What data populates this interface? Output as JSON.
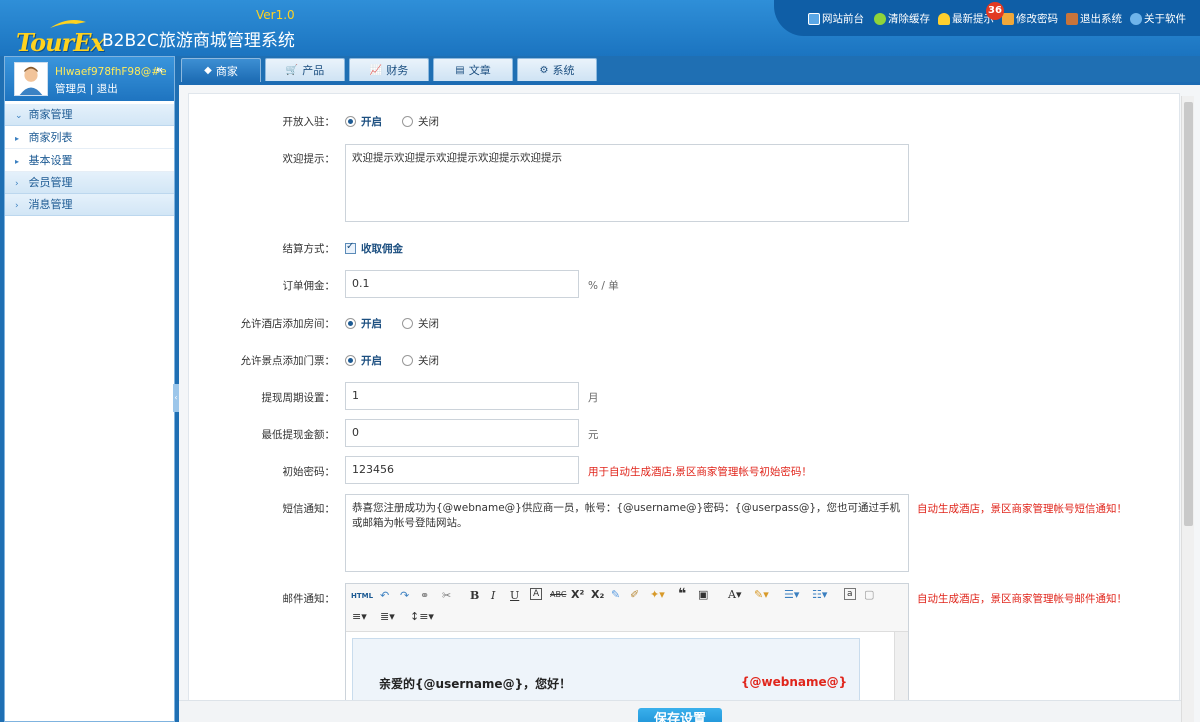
{
  "header": {
    "logo_text": "TourEx",
    "title": "B2B2C旅游商城管理系统",
    "version": "Ver1.0",
    "links": [
      {
        "label": "网站前台",
        "icon": "monitor-icon"
      },
      {
        "label": "清除缓存",
        "icon": "refresh-icon"
      },
      {
        "label": "最新提示",
        "icon": "bell-icon"
      },
      {
        "label": "修改密码",
        "icon": "lock-icon"
      },
      {
        "label": "退出系统",
        "icon": "exit-icon"
      },
      {
        "label": "关于软件",
        "icon": "info-icon"
      }
    ],
    "notification_count": "36"
  },
  "user": {
    "name": "Hlwaef978fhF98@#e",
    "role": "管理员 | 退出"
  },
  "sidebar": {
    "groups": [
      {
        "label": "商家管理",
        "expanded": true
      },
      {
        "label": "会员管理",
        "expanded": false
      },
      {
        "label": "消息管理",
        "expanded": false
      }
    ],
    "items": [
      {
        "label": "商家列表"
      },
      {
        "label": "基本设置"
      }
    ]
  },
  "tabs": [
    {
      "label": "商家",
      "icon": "tag-icon",
      "active": true
    },
    {
      "label": "产品",
      "icon": "cart-icon"
    },
    {
      "label": "财务",
      "icon": "chart-icon"
    },
    {
      "label": "文章",
      "icon": "newspaper-icon"
    },
    {
      "label": "系统",
      "icon": "gear-icon"
    }
  ],
  "form": {
    "open_join": {
      "label": "开放入驻：",
      "on": "开启",
      "off": "关闭",
      "value": "开启"
    },
    "welcome": {
      "label": "欢迎提示：",
      "value": "欢迎提示欢迎提示欢迎提示欢迎提示欢迎提示"
    },
    "settle": {
      "label": "结算方式：",
      "option": "收取佣金",
      "checked": true
    },
    "commission": {
      "label": "订单佣金：",
      "value": "0.1",
      "unit": "% / 单"
    },
    "hotel_room": {
      "label": "允许酒店添加房间：",
      "on": "开启",
      "off": "关闭",
      "value": "开启"
    },
    "scenic_ticket": {
      "label": "允许景点添加门票：",
      "on": "开启",
      "off": "关闭",
      "value": "开启"
    },
    "withdraw_period": {
      "label": "提现周期设置：",
      "value": "1",
      "unit": "月"
    },
    "min_withdraw": {
      "label": "最低提现金额：",
      "value": "0",
      "unit": "元"
    },
    "init_password": {
      "label": "初始密码：",
      "value": "123456",
      "note": "用于自动生成酒店,景区商家管理帐号初始密码！"
    },
    "sms": {
      "label": "短信通知：",
      "value": "恭喜您注册成功为{@webname@}供应商一员，帐号：{@username@}密码：{@userpass@}，您也可通过手机或邮箱为帐号登陆网站。",
      "note": "自动生成酒店，景区商家管理帐号短信通知！"
    },
    "email": {
      "label": "邮件通知：",
      "note": "自动生成酒店，景区商家管理帐号邮件通知！",
      "greeting": "亲爱的{@username@}，您好！",
      "webname": "{@webname@}"
    }
  },
  "save_button": "保存设置",
  "colors": {
    "accent": "#1c6bb3",
    "warning": "#e0261c",
    "highlight": "#ffd21f"
  }
}
